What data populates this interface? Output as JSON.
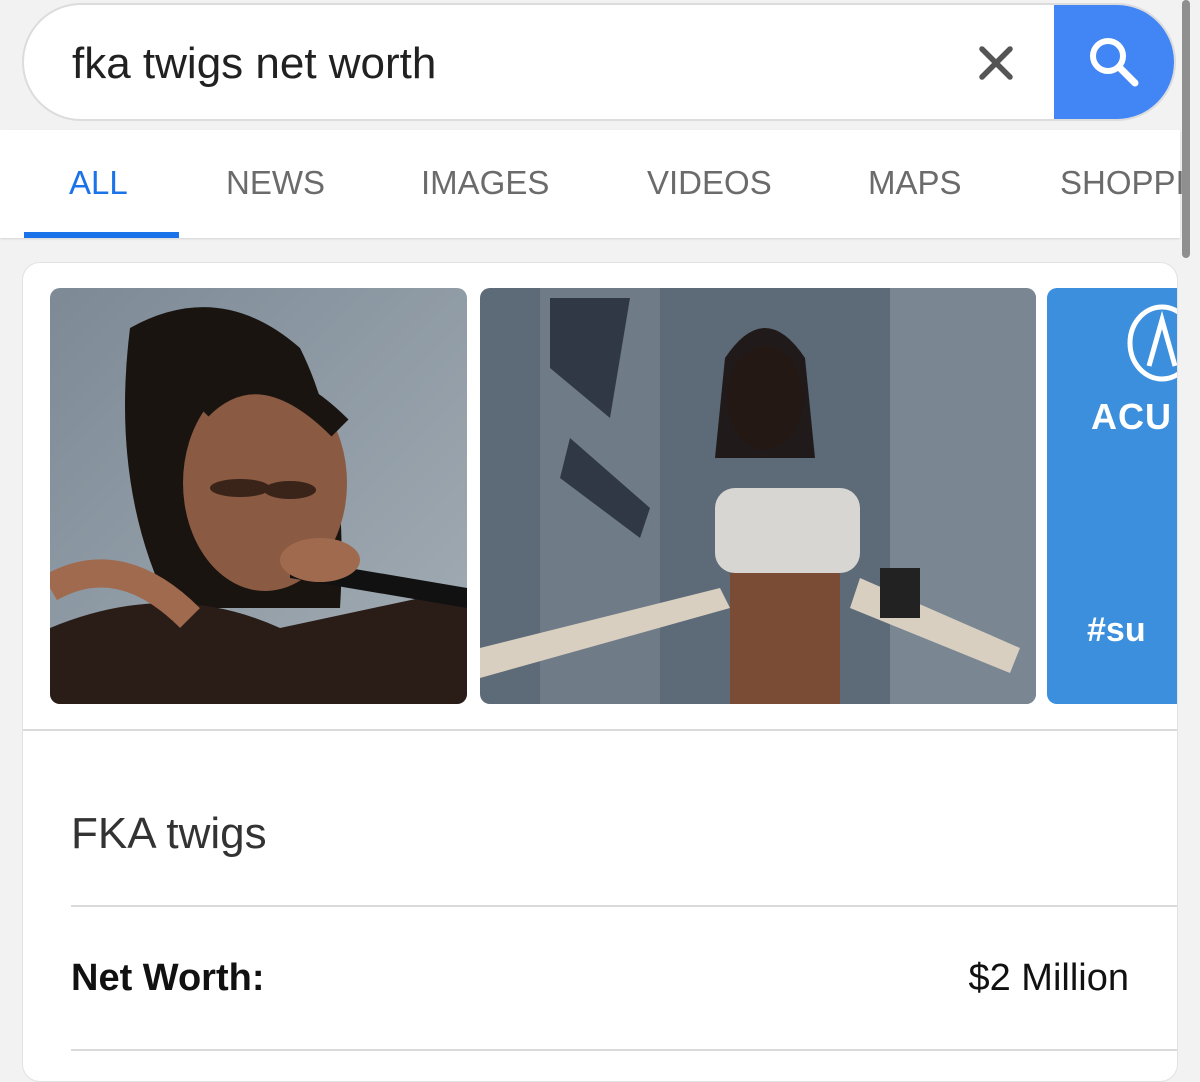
{
  "search": {
    "query": "fka twigs net worth",
    "clear_icon": "close-icon",
    "search_icon": "search-icon",
    "accent_color": "#4285f4"
  },
  "tabs": [
    {
      "label": "ALL",
      "active": true
    },
    {
      "label": "NEWS",
      "active": false
    },
    {
      "label": "IMAGES",
      "active": false
    },
    {
      "label": "VIDEOS",
      "active": false
    },
    {
      "label": "MAPS",
      "active": false
    },
    {
      "label": "SHOPPI",
      "active": false
    }
  ],
  "knowledge_panel": {
    "images": [
      {
        "subject": "singer with microphone"
      },
      {
        "subject": "performer on stage"
      },
      {
        "subject": "blue event backdrop",
        "visible_text": "ACU",
        "visible_hashtag": "#su"
      }
    ],
    "title": "FKA twigs",
    "facts": [
      {
        "label": "Net Worth:",
        "value": "$2 Million"
      }
    ]
  }
}
